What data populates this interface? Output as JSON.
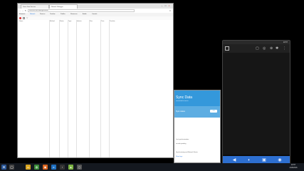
{
  "browser": {
    "tabs": [
      {
        "label": "Demo Data Sources",
        "active": false
      },
      {
        "label": "Network Debugger",
        "active": true
      }
    ],
    "url": "localhost:3000/debug/network",
    "devtools_tabs": [
      "Elements",
      "Network",
      "Sources",
      "Timeline",
      "Profiles",
      "Resources",
      "Audits",
      "Console"
    ],
    "active_devtab": "Network",
    "columns": [
      "Name",
      "Method",
      "Status",
      "Type",
      "Initiator",
      "Size",
      "Time",
      "Timeline"
    ],
    "win_buttons": [
      "–",
      "□",
      "×"
    ]
  },
  "phone": {
    "time": "10:57",
    "nav_icons": [
      "back-icon",
      "home-icon",
      "recents-icon"
    ],
    "emu_icons": [
      "rotate-icon",
      "volume-icon",
      "power-icon",
      "camera-icon"
    ]
  },
  "app": {
    "title": "Sync Data",
    "subtitle": "connected to server",
    "band_text": "Sync status",
    "badge": "ON",
    "labels": [
      "Last synchronization",
      "records pending",
      "Synchronizing and Network Status"
    ],
    "link": "Show logs"
  },
  "taskbar": {
    "clock": "10:57",
    "date": "4/19/2016",
    "icons": [
      "start-icon",
      "explorer-icon",
      "chrome-icon",
      "firefox-icon",
      "ie-icon",
      "terminal-icon",
      "studio-icon",
      "emulator-icon"
    ]
  },
  "colors": {
    "accent": "#3498db",
    "taskbar": "#14181f",
    "emulator_bar": "#2d6fd1"
  }
}
